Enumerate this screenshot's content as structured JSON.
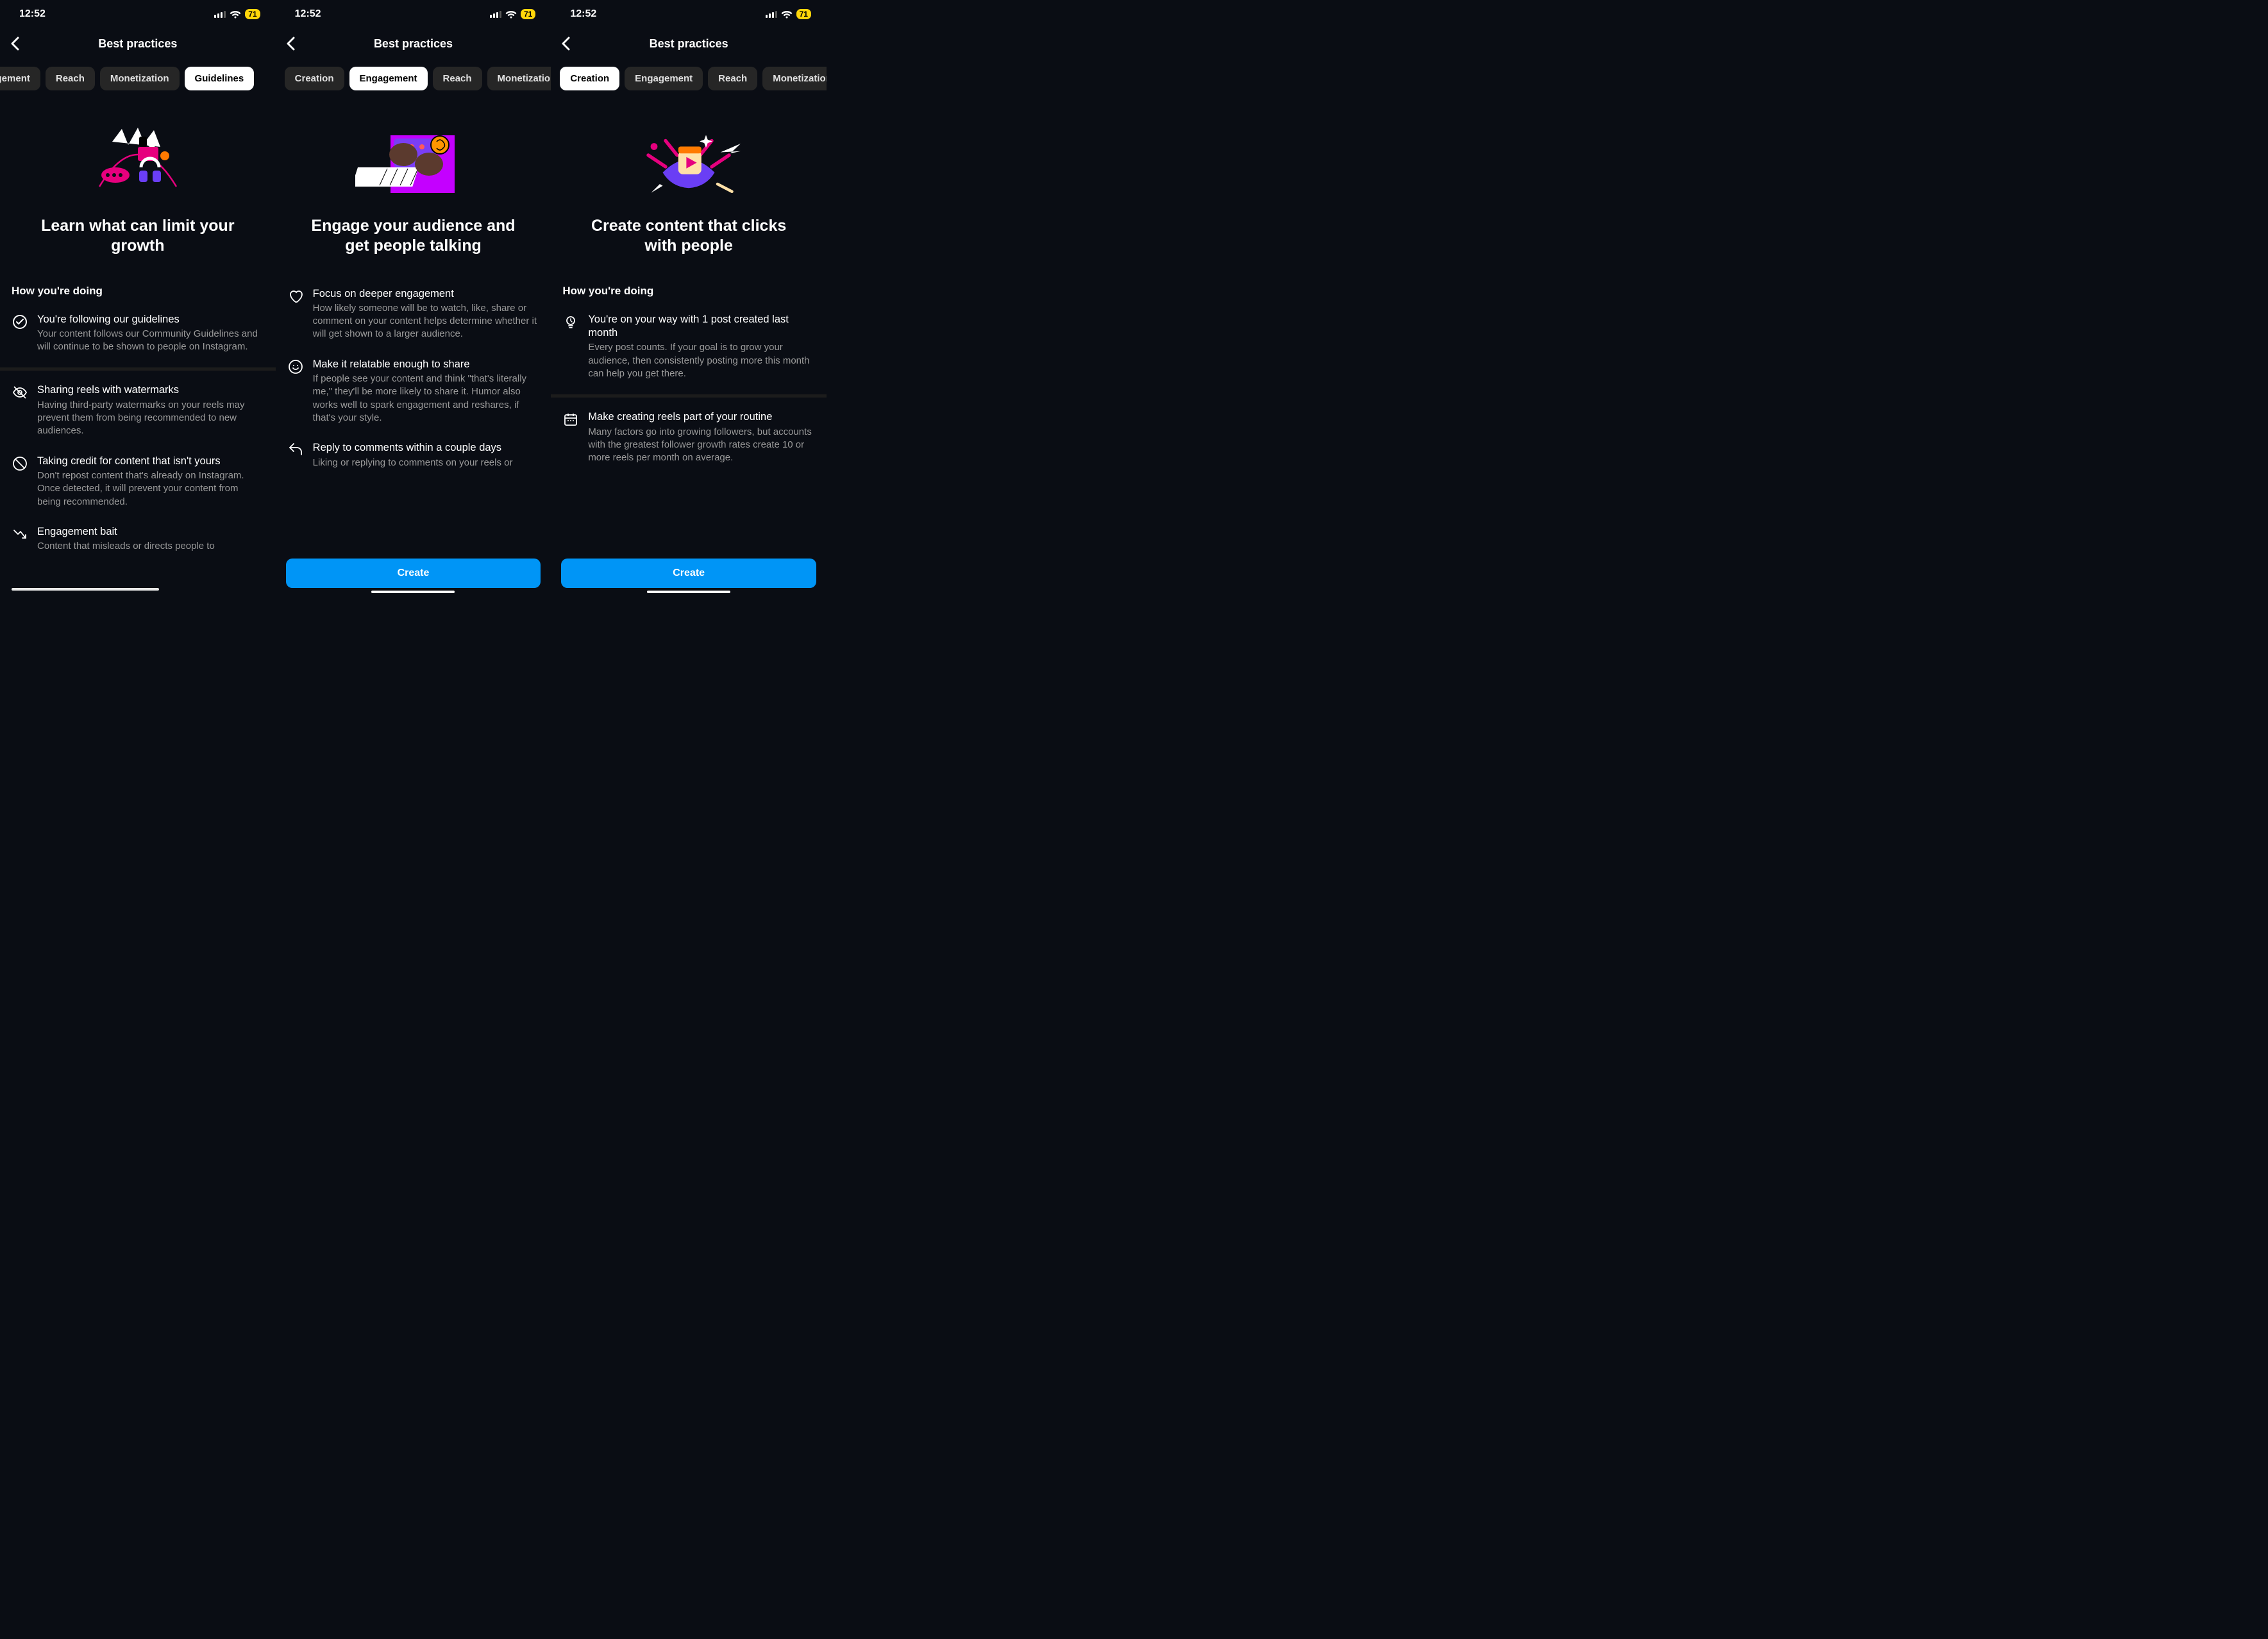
{
  "status": {
    "time": "12:52",
    "battery": "71"
  },
  "nav": {
    "title": "Best practices"
  },
  "screens": [
    {
      "tabs": [
        "gagement",
        "Reach",
        "Monetization",
        "Guidelines"
      ],
      "tabs_active": 3,
      "hero_title": "Learn what can limit your growth",
      "section_label": "How you're doing",
      "items": [
        {
          "icon": "check-circle",
          "title": "You're following our guidelines",
          "desc": "Your content follows our Community Guidelines and will continue to be shown to people on Instagram."
        }
      ],
      "items2": [
        {
          "icon": "eye-off",
          "title": "Sharing reels with watermarks",
          "desc": "Having third-party watermarks on your reels may prevent them from being recommended to new audiences."
        },
        {
          "icon": "no-circle",
          "title": "Taking credit for content that isn't yours",
          "desc": "Don't repost content that's already on Instagram. Once detected, it will prevent your content from being recommended."
        },
        {
          "icon": "trend-down",
          "title": "Engagement bait",
          "desc": "Content that misleads or directs people to"
        }
      ],
      "cta": null
    },
    {
      "tabs": [
        "Creation",
        "Engagement",
        "Reach",
        "Monetization"
      ],
      "tabs_active": 1,
      "hero_title": "Engage your audience and get people talking",
      "section_label": null,
      "items": [
        {
          "icon": "heart",
          "title": "Focus on deeper engagement",
          "desc": "How likely someone will be to watch, like, share or comment on your content helps determine whether it will get shown to a larger audience."
        },
        {
          "icon": "smile",
          "title": "Make it relatable enough to share",
          "desc": "If people see your content and think \"that's literally me,\" they'll be more likely to share it. Humor also works well to spark engagement and reshares, if that's your style."
        },
        {
          "icon": "reply",
          "title": "Reply to comments within a couple days",
          "desc": "Liking or replying to comments on your reels or"
        }
      ],
      "items2": [],
      "cta": "Create"
    },
    {
      "tabs": [
        "Creation",
        "Engagement",
        "Reach",
        "Monetization"
      ],
      "tabs_active": 0,
      "hero_title": "Create content that clicks with people",
      "section_label": "How you're doing",
      "items": [
        {
          "icon": "bulb",
          "title": "You're on your way with 1 post created last month",
          "desc": "Every post counts. If your goal is to grow your audience, then consistently posting more this month can help you get there."
        }
      ],
      "items2": [
        {
          "icon": "calendar",
          "title": "Make creating reels part of your routine",
          "desc": "Many factors go into growing followers, but accounts with the greatest follower growth rates create 10 or more reels per month on average."
        }
      ],
      "cta": "Create"
    }
  ]
}
